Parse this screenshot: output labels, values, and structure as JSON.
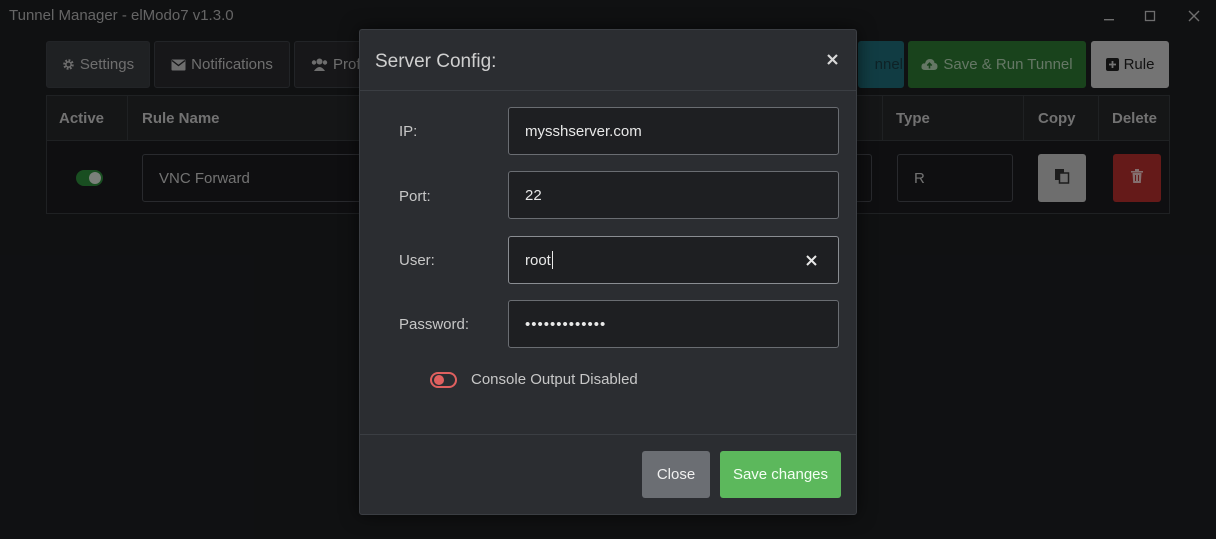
{
  "window": {
    "title": "Tunnel Manager - elModo7 v1.3.0",
    "controls": [
      "minimize-icon",
      "maximize-icon",
      "close-icon"
    ]
  },
  "toolbar": {
    "settings_label": "Settings",
    "notifications_label": "Notifications",
    "profiles_label": "Prof",
    "tunnel_label": "nnel",
    "save_run_label": "Save & Run Tunnel",
    "rule_label": "Rule"
  },
  "table": {
    "headers": {
      "active": "Active",
      "rule_name": "Rule Name",
      "type": "Type",
      "copy": "Copy",
      "delete": "Delete"
    },
    "rows": [
      {
        "active": true,
        "rule_name": "VNC Forward",
        "type": "R"
      }
    ]
  },
  "modal": {
    "title": "Server Config:",
    "fields": {
      "ip_label": "IP:",
      "ip_value": "mysshserver.com",
      "port_label": "Port:",
      "port_value": "22",
      "user_label": "User:",
      "user_value": "root",
      "password_label": "Password:",
      "password_value": "•••••••••••••"
    },
    "console_output": {
      "enabled": false,
      "label": "Console Output Disabled"
    },
    "close_label": "Close",
    "save_label": "Save changes"
  },
  "colors": {
    "background": "#1e1f22",
    "accent_green": "#5cb85c",
    "danger_red": "#b9302f",
    "info_teal": "#1f6d7a",
    "toggle_off": "#e0605f"
  }
}
